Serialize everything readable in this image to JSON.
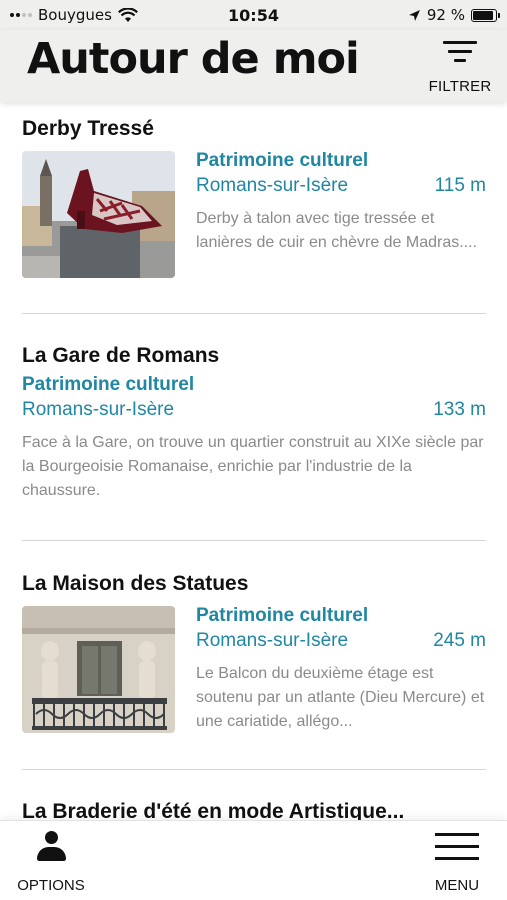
{
  "status_bar": {
    "carrier": "Bouygues",
    "time": "10:54",
    "battery": "92 %",
    "battery_level": 0.92
  },
  "header": {
    "title": "Autour de moi",
    "filter_label": "FILTRER"
  },
  "items": [
    {
      "title": "Derby Tressé",
      "category": "Patrimoine culturel",
      "city": "Romans-sur-Isère",
      "distance": "115 m",
      "description": "Derby à talon avec tige tressée et lanières de cuir en chèvre de Madras...."
    },
    {
      "title": "La Gare de Romans",
      "category": "Patrimoine culturel",
      "city": "Romans-sur-Isère",
      "distance": "133 m",
      "description": "Face à la Gare, on trouve un quartier construit au XIXe siècle par la Bourgeoisie Romanaise, enrichie par l'industrie de la chaussure."
    },
    {
      "title": "La Maison des Statues",
      "category": "Patrimoine culturel",
      "city": "Romans-sur-Isère",
      "distance": "245 m",
      "description": "Le Balcon du deuxième étage est soutenu par un atlante (Dieu Mercure) et une cariatide, allégo..."
    },
    {
      "title": "La Braderie d'été en mode Artistique..."
    }
  ],
  "bottom_bar": {
    "options_label": "OPTIONS",
    "menu_label": "MENU"
  },
  "colors": {
    "accent": "#1f86a3",
    "header_bg": "#efefed",
    "muted_text": "#8a8a8a"
  }
}
